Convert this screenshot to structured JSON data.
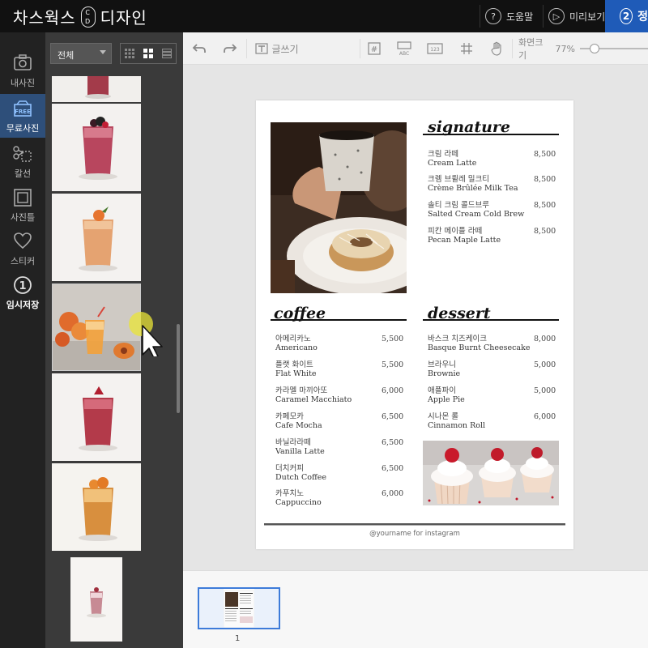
{
  "app": {
    "logo_left": "차스웍스",
    "logo_badge": "C D",
    "logo_right": "디자인",
    "help": "도움말",
    "preview": "미리보기",
    "step_number": "2",
    "step_label": "정"
  },
  "nav": [
    {
      "label": "내사진",
      "icon": "camera-icon"
    },
    {
      "label": "무료사진",
      "icon": "free-photo-icon",
      "badge": "FREE"
    },
    {
      "label": "칼선",
      "icon": "scissors-icon"
    },
    {
      "label": "사진틀",
      "icon": "frame-icon"
    },
    {
      "label": "스티커",
      "icon": "heart-icon"
    },
    {
      "label": "임시저장",
      "icon": "number-one-icon",
      "glyph": "1"
    }
  ],
  "photos": {
    "filter": "전체"
  },
  "toolbar": {
    "text_tool": "글쓰기",
    "zoom_label": "화면크기",
    "zoom_value": "77%",
    "zoom_level": 0.22
  },
  "menu": {
    "signature_title": "signature",
    "signature_items": [
      {
        "ko": "크림 라떼",
        "en": "Cream Latte",
        "price": "8,500"
      },
      {
        "ko": "크렘 브륄레 밀크티",
        "en": "Crème Brûlée Milk Tea",
        "price": "8,500"
      },
      {
        "ko": "솔티 크림 콜드브루",
        "en": "Salted Cream Cold Brew",
        "price": "8,500"
      },
      {
        "ko": "피칸 메이플 라떼",
        "en": "Pecan Maple Latte",
        "price": "8,500"
      }
    ],
    "coffee_title": "coffee",
    "coffee_items": [
      {
        "ko": "아메리카노",
        "en": "Americano",
        "price": "5,500"
      },
      {
        "ko": "플랫 화이트",
        "en": "Flat White",
        "price": "5,500"
      },
      {
        "ko": "카라멜 마끼아또",
        "en": "Caramel Macchiato",
        "price": "6,000"
      },
      {
        "ko": "카페모카",
        "en": "Cafe Mocha",
        "price": "6,500"
      },
      {
        "ko": "바닐라라떼",
        "en": "Vanilla Latte",
        "price": "6,500"
      },
      {
        "ko": "더치커피",
        "en": "Dutch Coffee",
        "price": "6,500"
      },
      {
        "ko": "카푸치노",
        "en": "Cappuccino",
        "price": "6,000"
      }
    ],
    "dessert_title": "dessert",
    "dessert_items": [
      {
        "ko": "바스크 치즈케이크",
        "en": "Basque Burnt Cheesecake",
        "price": "8,000"
      },
      {
        "ko": "브라우니",
        "en": "Brownie",
        "price": "5,000"
      },
      {
        "ko": "애플파이",
        "en": "Apple Pie",
        "price": "5,000"
      },
      {
        "ko": "시나몬 롤",
        "en": "Cinnamon Roll",
        "price": "6,000"
      }
    ],
    "footer": "@yourname for instagram"
  },
  "pages": {
    "current": "1"
  }
}
